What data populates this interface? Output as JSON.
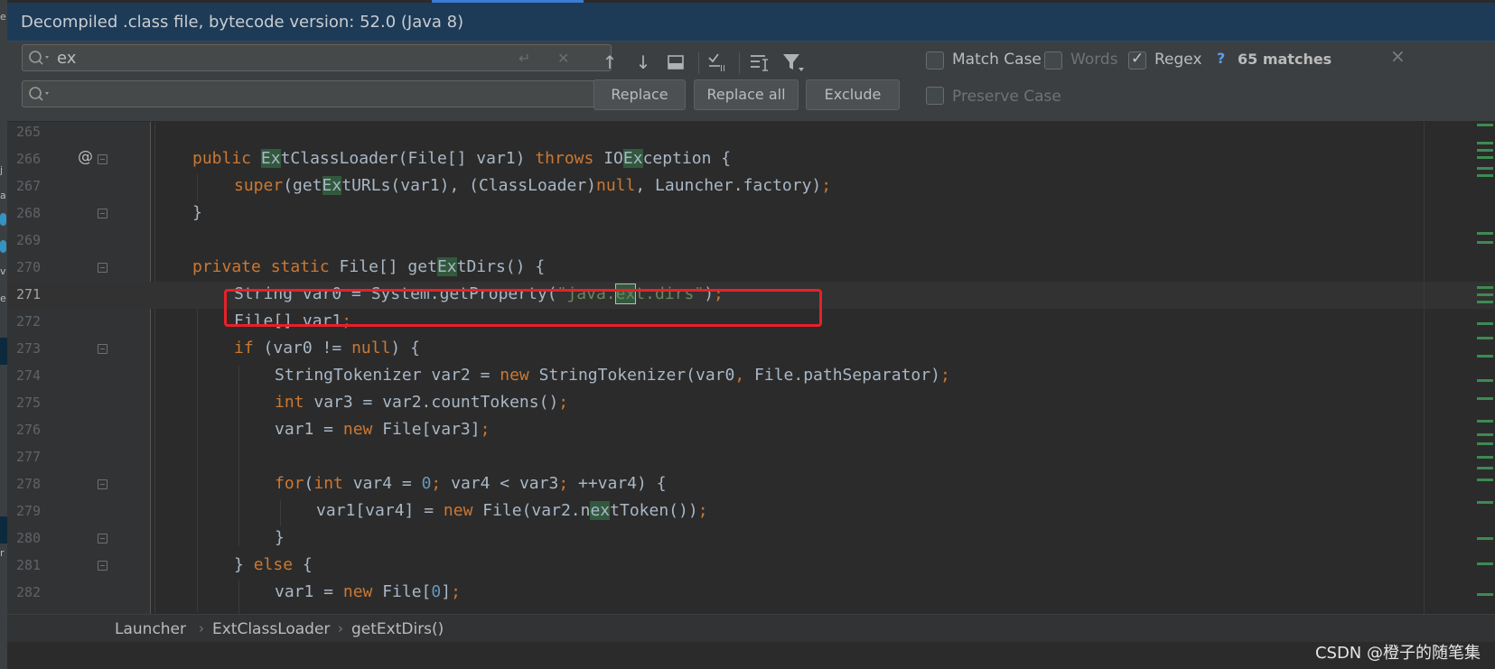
{
  "banner": {
    "text": "Decompiled .class file, bytecode version: 52.0 (Java 8)"
  },
  "find": {
    "search_value": "ex",
    "replace_value": "",
    "icons": {
      "search": "search-icon",
      "newline": "newline-icon",
      "clear": "clear-icon",
      "prev": "arrow-up-icon",
      "next": "arrow-down-icon",
      "select_all": "select-occurrences-icon",
      "add_selection": "add-selection-icon",
      "filter_text": "text-filter-icon",
      "filter": "filter-icon"
    },
    "match_case": {
      "label": "Match Case",
      "checked": false
    },
    "words": {
      "label": "Words",
      "checked": false
    },
    "regex": {
      "label": "Regex",
      "checked": true
    },
    "help_label": "?",
    "matches": "65 matches",
    "close_label": "×",
    "preserve_case": {
      "label": "Preserve Case",
      "checked": false
    },
    "replace_label": "Replace",
    "replace_all_label": "Replace all",
    "exclude_label": "Exclude"
  },
  "editor": {
    "line_numbers": [
      "265",
      "266",
      "267",
      "268",
      "269",
      "270",
      "271",
      "272",
      "273",
      "274",
      "275",
      "276",
      "277",
      "278",
      "279",
      "280",
      "281",
      "282"
    ],
    "annotation_mark": "@",
    "current_line": "271"
  },
  "breadcrumb": [
    "Launcher",
    "ExtClassLoader",
    "getExtDirs()"
  ],
  "watermark": "CSDN @橙子的随笔集",
  "colors": {
    "background": "#2b2b2b",
    "keyword": "#cc7832",
    "string": "#6a8759",
    "number": "#6897bb",
    "match_highlight": "#32593d",
    "annotation_box": "#e8202a"
  }
}
